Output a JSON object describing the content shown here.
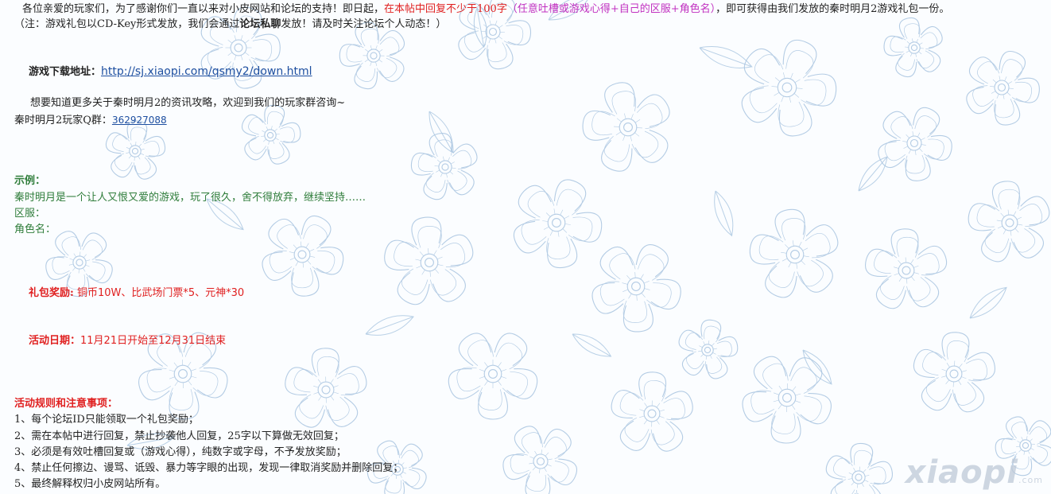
{
  "intro": {
    "greeting": "各位亲爱的玩家们，为了感谢你们一直以来对小皮网站和论坛的支持！即日起，",
    "highlight": "在本帖中回复不少于100字",
    "format_note": "（任意吐槽或游戏心得+自己的区服+角色名）",
    "reward_text": "，即可获得由我们发放的秦时明月2游戏礼包一份。"
  },
  "note": {
    "part1": "（注：游戏礼包以CD-Key形式发放，我们会通过",
    "bold": "论坛私聊",
    "part2": "发放！请及时关注论坛个人动态！）"
  },
  "download": {
    "label": "游戏下载地址：",
    "url": "http://sj.xiaopi.com/qsmy2/down.html"
  },
  "info": {
    "text": "想要知道更多关于秦时明月2的资讯攻略，欢迎到我们的玩家群咨询~",
    "qq_label": "秦时明月2玩家Q群：",
    "qq_number": "362927088"
  },
  "example": {
    "title": "示例：",
    "content": "秦时明月是一个让人又恨又爱的游戏，玩了很久，舍不得放弃，继续坚持……",
    "server_label": "区服：",
    "role_label": "角色名："
  },
  "gift": {
    "label": "礼包奖励:",
    "value": " 铜币10W、比武场门票*5、元神*30"
  },
  "date": {
    "label": "活动日期：",
    "value": "11月21日开始至12月31日结束"
  },
  "rules": {
    "title": "活动规则和注意事项：",
    "items": [
      "1、每个论坛ID只能领取一个礼包奖励；",
      "2、需在本帖中进行回复，禁止抄袭他人回复，25字以下算做无效回复；",
      "3、必须是有效吐槽回复或（游戏心得），纯数字或字母，不予发放奖励；",
      "4、禁止任何擦边、谩骂、诋毁、暴力等字眼的出现，发现一律取消奖励并删除回复；",
      "5、最终解释权归小皮网站所有。"
    ]
  },
  "watermark": {
    "text": "xiaopi",
    "suffix": ".com"
  },
  "colors": {
    "accent_red": "#e02020",
    "accent_magenta": "#c030c0",
    "example_green": "#2f7d3a",
    "link_blue": "#1e4fa0",
    "floral_blue": "#a8c4e0"
  }
}
